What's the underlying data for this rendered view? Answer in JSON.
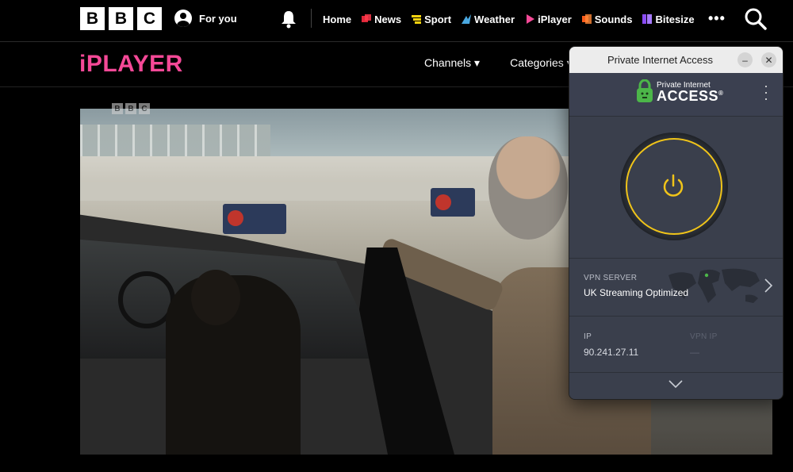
{
  "top_nav": {
    "logo_letters": [
      "B",
      "B",
      "C"
    ],
    "for_you": "For you",
    "links": [
      {
        "label": "Home",
        "icon": "none",
        "color": ""
      },
      {
        "label": "News",
        "icon": "news-icon",
        "color": "#e0283a"
      },
      {
        "label": "Sport",
        "icon": "sport-icon",
        "color": "#f6d20f"
      },
      {
        "label": "Weather",
        "icon": "weather-icon",
        "color": "#4aa8e0"
      },
      {
        "label": "iPlayer",
        "icon": "iplayer-icon",
        "color": "#f54997"
      },
      {
        "label": "Sounds",
        "icon": "sounds-icon",
        "color": "#f65a1a"
      },
      {
        "label": "Bitesize",
        "icon": "bitesize-icon",
        "color": "#8a4cf7"
      }
    ],
    "more": "•••"
  },
  "iplayer": {
    "logo": "iPLAYER",
    "menu": [
      {
        "label": "Channels ▾"
      },
      {
        "label": "Categories ▾"
      }
    ]
  },
  "video": {
    "watermark": [
      "B",
      "B",
      "C"
    ]
  },
  "pia": {
    "window_title": "Private Internet Access",
    "minimize": "–",
    "close": "✕",
    "brand_small": "Private Internet",
    "brand_big": "ACCESS",
    "brand_mark": "®",
    "power_ring_color": "#f0c419",
    "server_label": "VPN SERVER",
    "server_value": "UK Streaming Optimized",
    "ip_label": "IP",
    "ip_value": "90.241.27.11",
    "vpn_ip_label": "VPN IP",
    "vpn_ip_value": "—"
  }
}
